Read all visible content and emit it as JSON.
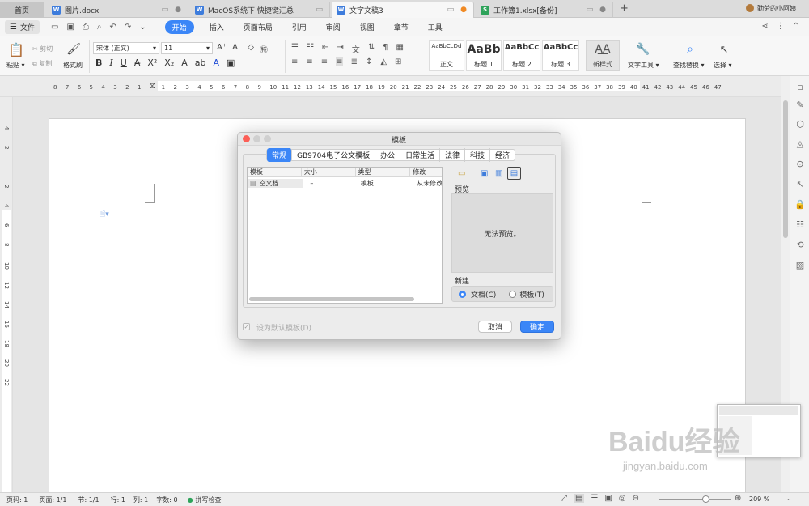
{
  "tabs": {
    "home": "首页",
    "doc1": "图片.docx",
    "doc2": "MacOS系统下 快捷键汇总",
    "doc3": "文字文稿3",
    "xls": "工作簿1.xlsx[备份]",
    "add": "+",
    "user": "勤劳的小阿姨"
  },
  "menu": {
    "file": "文件",
    "items": [
      "开始",
      "插入",
      "页面布局",
      "引用",
      "审阅",
      "视图",
      "章节",
      "工具"
    ]
  },
  "ribbon": {
    "paste": "粘贴",
    "cut": "剪切",
    "copy": "复制",
    "format_painter": "格式刷",
    "font": "宋体 (正文)",
    "size": "11",
    "bold": "B",
    "italic": "I",
    "underline": "U",
    "styles": [
      {
        "preview": "AaBbCcDd",
        "label": "正文"
      },
      {
        "preview": "AaBb",
        "label": "标题 1"
      },
      {
        "preview": "AaBbCc",
        "label": "标题 2"
      },
      {
        "preview": "AaBbCc",
        "label": "标题 3"
      }
    ],
    "new_style": "新样式",
    "text_tools": "文字工具",
    "find_replace": "查找替换",
    "select": "选择"
  },
  "ruler": {
    "ticks": [
      "8",
      "7",
      "6",
      "5",
      "4",
      "3",
      "2",
      "1",
      "",
      "1",
      "2",
      "3",
      "4",
      "5",
      "6",
      "7",
      "8",
      "9",
      "10",
      "11",
      "12",
      "13",
      "14",
      "15",
      "16",
      "17",
      "18",
      "19",
      "20",
      "21",
      "22",
      "23",
      "24",
      "25",
      "26",
      "27",
      "28",
      "29",
      "30",
      "31",
      "32",
      "33",
      "34",
      "35",
      "36",
      "37",
      "38",
      "39",
      "40",
      "41",
      "42",
      "43",
      "44",
      "45",
      "46",
      "47"
    ]
  },
  "vruler": {
    "ticks": [
      "4",
      "2",
      "",
      "2",
      "4",
      "6",
      "8",
      "10",
      "12",
      "14",
      "16",
      "18",
      "20",
      "22"
    ]
  },
  "dialog": {
    "title": "模板",
    "tabs": [
      "常规",
      "GB9704电子公文模板",
      "办公",
      "日常生活",
      "法律",
      "科技",
      "经济"
    ],
    "columns": [
      "模板",
      "大小",
      "类型",
      "修改"
    ],
    "rows": [
      {
        "name": "空文档",
        "size": "–",
        "type": "模板",
        "modified": "从未修改"
      }
    ],
    "preview_label": "预览",
    "no_preview": "无法预览。",
    "new_label": "新建",
    "radio_doc": "文档(C)",
    "radio_template": "模板(T)",
    "default_checkbox": "设为默认模板(D)",
    "cancel": "取消",
    "ok": "确定"
  },
  "status": {
    "page_code": "页码: 1",
    "pages": "页面: 1/1",
    "section": "节: 1/1",
    "row": "行: 1",
    "col": "列: 1",
    "words": "字数: 0",
    "spell": "拼写检查",
    "zoom": "209 %"
  },
  "watermark": {
    "brand": "Baidu经验",
    "url": "jingyan.baidu.com"
  },
  "colors": {
    "accent": "#3b86f7",
    "word_blue": "#3d7cdc",
    "excel_green": "#2ea35a"
  }
}
